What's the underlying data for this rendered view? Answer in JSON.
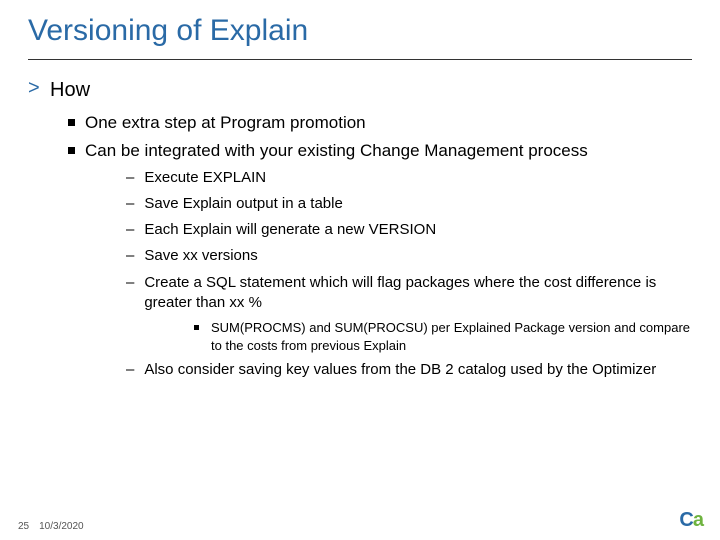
{
  "title": "Versioning of Explain",
  "section": "How",
  "bullets": {
    "b1": "One extra step at Program promotion",
    "b2": "Can be integrated with your existing Change Management process"
  },
  "dashes": {
    "d1": "Execute EXPLAIN",
    "d2": "Save Explain output in a table",
    "d3": "Each Explain will generate a new VERSION",
    "d4": "Save xx versions",
    "d5": "Create a SQL statement which will flag packages where the cost difference is greater than xx %",
    "d6": "Also consider saving key values from the DB 2 catalog used by the Optimizer"
  },
  "sub": {
    "s1": "SUM(PROCMS) and SUM(PROCSU) per Explained Package version and compare to the costs from previous Explain"
  },
  "footer": {
    "page": "25",
    "date": "10/3/2020"
  },
  "logo": {
    "c": "C",
    "a": "a"
  }
}
